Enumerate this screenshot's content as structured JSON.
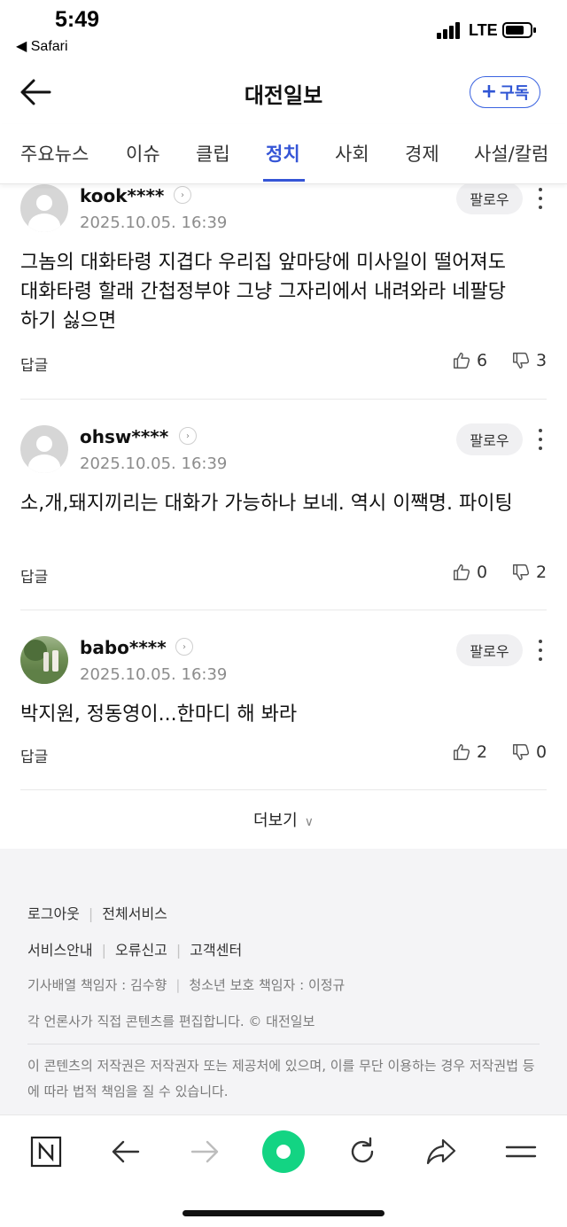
{
  "status_bar": {
    "time": "5:49",
    "back_app": "◀ Safari",
    "network": "LTE"
  },
  "header": {
    "title": "대전일보",
    "subscribe_label": "구독"
  },
  "tabs": [
    {
      "label": "주요뉴스"
    },
    {
      "label": "이슈"
    },
    {
      "label": "클립"
    },
    {
      "label": "정치",
      "active": true
    },
    {
      "label": "사회"
    },
    {
      "label": "경제"
    },
    {
      "label": "사설/칼럼"
    }
  ],
  "comments": [
    {
      "username": "kook****",
      "date": "2025.10.05. 16:39",
      "follow_label": "팔로우",
      "text": "그놈의 대화타령 지겹다 우리집 앞마당에 미사일이 떨어져도 대화타령 할래 간첩정부야 그냥 그자리에서 내려와라 네팔당하기 싫으면",
      "reply_label": "답글",
      "likes": "6",
      "dislikes": "3",
      "avatar": "default"
    },
    {
      "username": "ohsw****",
      "date": "2025.10.05. 16:39",
      "follow_label": "팔로우",
      "text": "소,개,돼지끼리는 대화가 가능하나 보네. 역시 이짹명. 파이팅",
      "reply_label": "답글",
      "likes": "0",
      "dislikes": "2",
      "avatar": "default"
    },
    {
      "username": "babo****",
      "date": "2025.10.05. 16:39",
      "follow_label": "팔로우",
      "text": "박지원, 정동영이...한마디 해 봐라",
      "reply_label": "답글",
      "likes": "2",
      "dislikes": "0",
      "avatar": "photo"
    }
  ],
  "more_label": "더보기",
  "footer": {
    "links_row1": [
      "로그아웃",
      "전체서비스"
    ],
    "links_row2": [
      "서비스안내",
      "오류신고",
      "고객센터"
    ],
    "managers": [
      "기사배열 책임자 : 김수향",
      "청소년 보호 책임자 : 이정규"
    ],
    "editing_notice": "각 언론사가 직접 콘텐츠를 편집합니다. © 대전일보",
    "copyright": "이 콘텐츠의 저작권은 저작권자 또는 제공처에 있으며, 이를 무단 이용하는 경우 저작권법 등에 따라 법적 책임을 질 수 있습니다."
  },
  "toolbar": [
    "naver-icon",
    "back-arrow-icon",
    "forward-arrow-icon",
    "green-dot-icon",
    "refresh-icon",
    "share-icon",
    "menu-icon"
  ],
  "colors": {
    "accent": "#3555d6",
    "green": "#13d483"
  }
}
